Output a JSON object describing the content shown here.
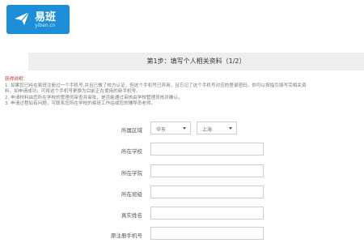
{
  "header": {
    "brand": "易班",
    "url": "yiban.cn"
  },
  "step": {
    "title": "第1步：填写个人相关资料（1/2）"
  },
  "notes": {
    "title": "获得说明：",
    "items": [
      "1. 如果您已经在易班注册过一个手机号,并且已做了校方认证，但这个手机号已弃用，且忘记了这个手机号对应的登录密码。你可以按指引填写完相关资",
      "    料，如申请成功，可将这个手机号更换为目前正在使用的新手机号。",
      "2. 申请材料由您所在学校的管理员审查并审批，是否能通过审核由学校管理员核对确认。",
      "3. 申请过程如有问题，可联系您所在学校的易班工作站或您的辅导员老师。"
    ]
  },
  "form": {
    "region": {
      "label": "所属区域",
      "select1": "华东",
      "select2": "上海"
    },
    "fields": [
      {
        "label": "所在学校",
        "value": ""
      },
      {
        "label": "所在学院",
        "value": ""
      },
      {
        "label": "所在班级",
        "value": ""
      },
      {
        "label": "真实姓名",
        "value": ""
      },
      {
        "label": "原注册手机号",
        "value": ""
      }
    ]
  }
}
